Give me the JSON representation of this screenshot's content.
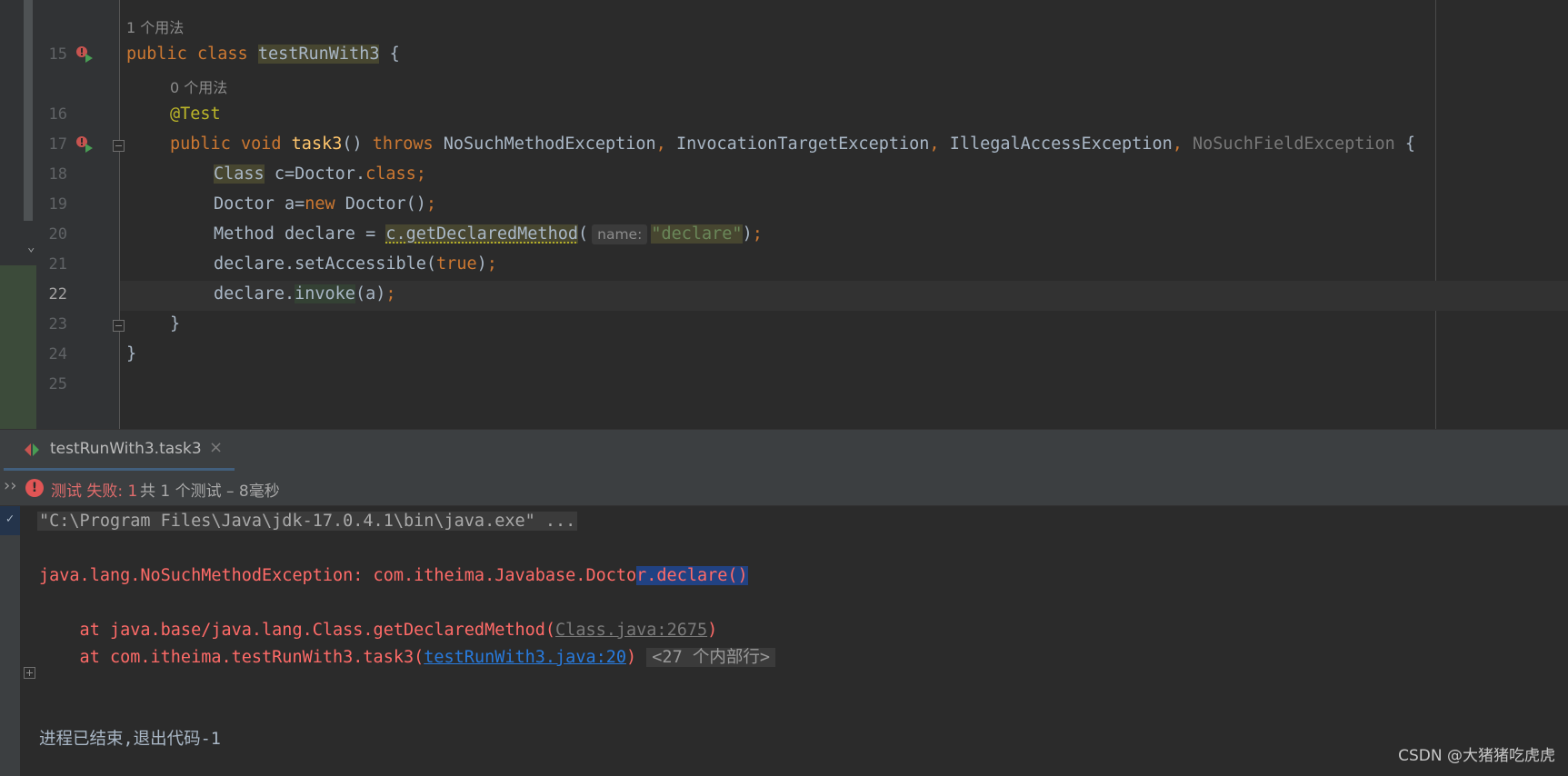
{
  "editor": {
    "usage_hints": {
      "class_usage": "1 个用法",
      "method_usage": "0 个用法"
    },
    "line_numbers": {
      "l15": "15",
      "l16": "16",
      "l17": "17",
      "l18": "18",
      "l19": "19",
      "l20": "20",
      "l21": "21",
      "l22": "22",
      "l23": "23",
      "l24": "24",
      "l25": "25"
    },
    "code": {
      "l15": {
        "kw1": "public",
        "kw2": "class",
        "name": "testRunWith3",
        "rest": " {"
      },
      "l16": {
        "annotation": "@Test"
      },
      "l17": {
        "kw1": "public",
        "kw2": "void",
        "name": "task3",
        "paren": "()",
        "throws": "throws",
        "ex1": "NoSuchMethodException",
        "ex2": "InvocationTargetException",
        "ex3": "IllegalAccessException",
        "ex4": "NoSuchFieldException",
        "brace": "{",
        "comma": ","
      },
      "l18": {
        "type": "Class",
        "rest": " c=Doctor.",
        "kw": "class",
        "semi": ";"
      },
      "l19": {
        "pre": "Doctor a=",
        "kw": "new",
        "post": " Doctor()",
        "semi": ";"
      },
      "l20": {
        "pre": "Method declare = ",
        "call": "c.getDeclaredMethod",
        "open": "(",
        "param_hint": "name:",
        "arg": "\"declare\"",
        "close": ")",
        "semi": ";"
      },
      "l21": {
        "pre": "declare.setAccessible(",
        "kw": "true",
        "close": ")",
        "semi": ";"
      },
      "l22": {
        "pre": "declare.",
        "call": "invoke",
        "post": "(a)",
        "semi": ";"
      },
      "l23": {
        "brace": "}"
      },
      "l24": {
        "brace": "}"
      }
    }
  },
  "run_panel": {
    "tab_label": "testRunWith3.task3",
    "tab_close": "×",
    "more_glyph": "››",
    "status": {
      "error_glyph": "!",
      "fail_text": "测试 失败: 1",
      "summary_text": "共 1 个测试 – 8毫秒"
    },
    "console": {
      "command": "\"C:\\Program Files\\Java\\jdk-17.0.4.1\\bin\\java.exe\" ...",
      "exception_pre": "java.lang.NoSuchMethodException: com.itheima.Javabase.Docto",
      "exception_sel": "r.declare()",
      "trace1_pre": "    at java.base/java.lang.Class.getDeclaredMethod(",
      "trace1_link": "Class.java:2675",
      "trace1_post": ")",
      "trace2_pre": "    at com.itheima.testRunWith3.task3(",
      "trace2_link": "testRunWith3.java:20",
      "trace2_post": ")",
      "trace2_fold": "<27 个内部行>",
      "exit": "进程已结束,退出代码-1"
    }
  },
  "watermark": "CSDN @大猪猪吃虎虎",
  "colors": {
    "background": "#2b2b2b",
    "keyword": "#cc7832",
    "function": "#ffc66d",
    "annotation": "#bbb529",
    "string": "#6a8759",
    "error": "#ff6b68",
    "link": "#287bde",
    "selection": "#214283"
  }
}
